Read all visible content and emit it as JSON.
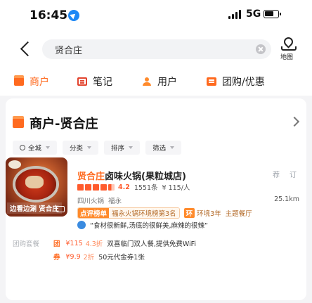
{
  "status_bar": {
    "time": "16:45",
    "network": "5G"
  },
  "search": {
    "query": "贤合庄",
    "map_label": "地图"
  },
  "tabs": [
    {
      "label": "商户",
      "active": true
    },
    {
      "label": "笔记",
      "active": false
    },
    {
      "label": "用户",
      "active": false
    },
    {
      "label": "团购/优惠",
      "active": false
    }
  ],
  "section": {
    "title": "商户-贤合庄"
  },
  "filters": [
    "全城",
    "分类",
    "排序",
    "筛选"
  ],
  "poi": {
    "image_label": "边看边涮 贤合庄",
    "name_highlight": "贤合庄",
    "name_rest": "卤味火锅(果粒城店)",
    "actions": [
      "荐",
      "订"
    ],
    "score": "4.2",
    "reviews": "1551条",
    "price": "¥ 115/人",
    "area": "四川火锅",
    "region": "福永",
    "distance": "25.1km",
    "rank_badge": "点评榜单",
    "rank_text": "福永火锅环境榜第3名",
    "grade_badge": "环",
    "grade_text": "环境3年",
    "vip_text": "主题餐厅",
    "quote": "“食材很新鲜,汤底的很鲜美,麻辣的很辣”"
  },
  "deals": [
    {
      "category": "团购套餐",
      "tag": "团",
      "price": "¥115",
      "discount": "4.3折",
      "desc": "双喜临门双人餐,提供免费WiFi"
    },
    {
      "category": "",
      "tag": "券",
      "price": "¥9.9",
      "discount": "2折",
      "desc": "50元代金券1张"
    }
  ],
  "colors": {
    "accent": "#ff6a1f",
    "star": "#ff5b2d",
    "blue": "#1e88f5"
  }
}
